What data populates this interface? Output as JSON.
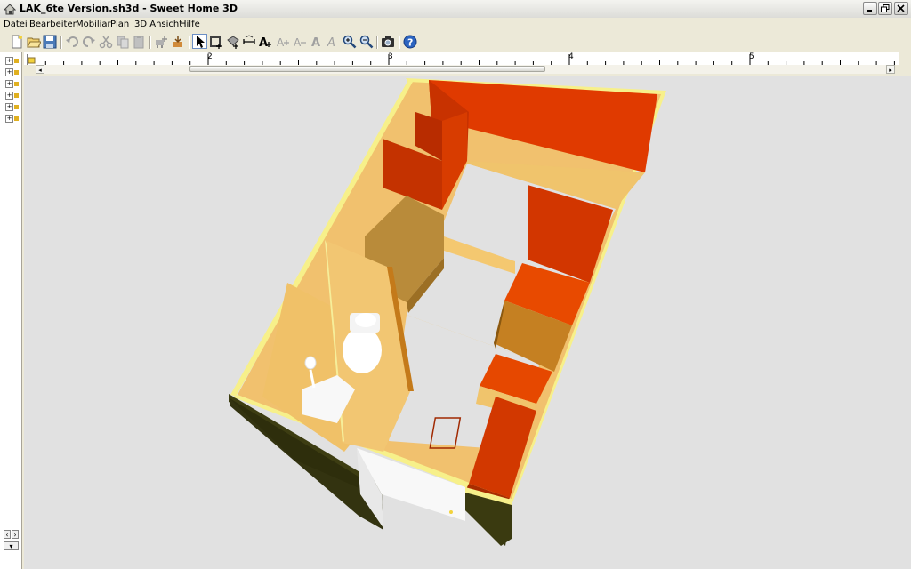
{
  "window": {
    "title": "LAK_6te Version.sh3d - Sweet Home 3D"
  },
  "menu": {
    "items": [
      "Datei",
      "Bearbeiten",
      "Mobiliar",
      "Plan",
      "3D Ansicht",
      "Hilfe"
    ]
  },
  "toolbar": {
    "buttons": [
      "new",
      "open",
      "save",
      "undo",
      "redo",
      "cut",
      "copy",
      "paste",
      "add-furniture",
      "import-furniture",
      "select",
      "create-walls",
      "create-rooms",
      "create-dimensions",
      "add-text",
      "modify-text",
      "modify-text-style",
      "bold",
      "italic",
      "zoom-in",
      "zoom-out",
      "create-photo",
      "help"
    ],
    "active": "select"
  },
  "ruler": {
    "labels": [
      "2",
      "3",
      "4",
      "5"
    ]
  },
  "colors": {
    "background_3d": "#e1e1e1",
    "wall_orange": "#e03a00",
    "floor_beige": "#f1c16e",
    "outer_wall": "#3a3a10"
  }
}
